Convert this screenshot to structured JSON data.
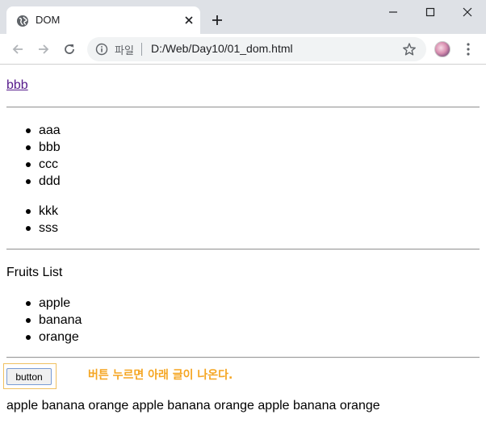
{
  "browser": {
    "tab": {
      "title": "DOM",
      "favicon": "globe-icon",
      "close_icon": "close-icon"
    },
    "new_tab_icon": "plus-icon",
    "window_controls": [
      "minimize-icon",
      "maximize-icon",
      "close-icon"
    ],
    "toolbar": {
      "back_icon": "arrow-left-icon",
      "forward_icon": "arrow-right-icon",
      "reload_icon": "reload-icon",
      "info_icon": "info-icon",
      "scheme_label": "파일",
      "url": "D:/Web/Day10/01_dom.html",
      "bookmark_icon": "star-icon",
      "menu_icon": "more-vert-icon"
    }
  },
  "page": {
    "link_text": "bbb",
    "list1": [
      "aaa",
      "bbb",
      "ccc",
      "ddd"
    ],
    "list2": [
      "kkk",
      "sss"
    ],
    "fruits_title": "Fruits List",
    "fruits": [
      "apple",
      "banana",
      "orange"
    ],
    "button_label": "button",
    "message": "버튼 누르면 아래 글이 나온다.",
    "output": "apple banana orange apple banana orange apple banana orange"
  },
  "colors": {
    "link_visited": "#551a8b",
    "message": "#f5a623",
    "tabstrip": "#dee1e6",
    "omnibox": "#f1f3f4"
  }
}
